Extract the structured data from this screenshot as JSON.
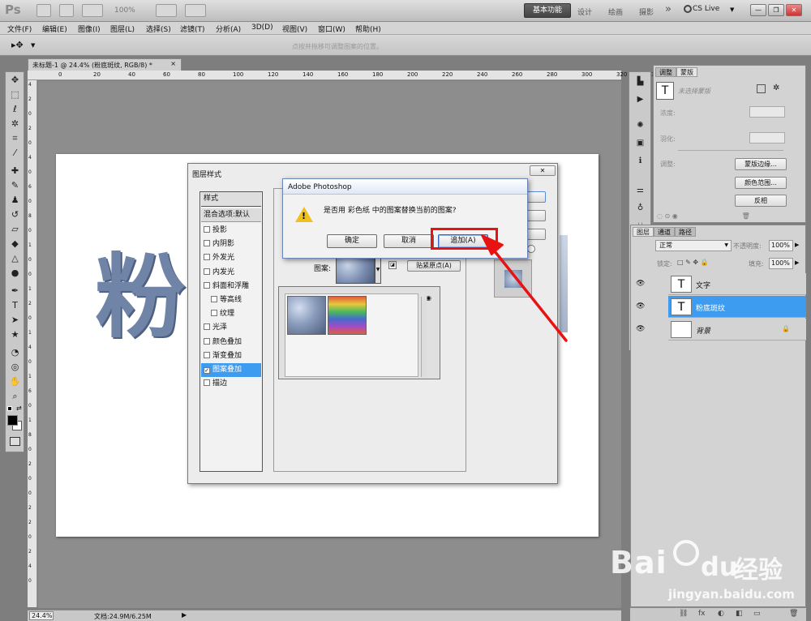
{
  "app": {
    "logo": "Ps",
    "zoom_field": "100%",
    "workspaces": [
      "基本功能",
      "设计",
      "绘画",
      "摄影"
    ],
    "more": "»",
    "cslive": "CS Live",
    "live_dropdown": "▼"
  },
  "menu": [
    "文件(F)",
    "编辑(E)",
    "图像(I)",
    "图层(L)",
    "选择(S)",
    "滤镜(T)",
    "分析(A)",
    "3D(D)",
    "视图(V)",
    "窗口(W)",
    "帮助(H)"
  ],
  "options": {
    "hint": "点按并拖移可调整图案的位置。"
  },
  "document": {
    "tab_title": "未标题-1 @ 24.4% (粉底斑纹, RGB/8) *",
    "tab_close": "×",
    "canvas_text": "粉",
    "canvas_text_right": "",
    "h_ruler": [
      "0",
      "20",
      "40",
      "60",
      "80",
      "100",
      "120",
      "140",
      "160",
      "180",
      "200",
      "220",
      "240",
      "260",
      "280",
      "300",
      "320",
      "340",
      "360",
      "380",
      "400",
      "420",
      "440"
    ],
    "v_ruler": [
      "4",
      "2",
      "0",
      "2",
      "0",
      "4",
      "0",
      "6",
      "0",
      "8",
      "0",
      "1",
      "0",
      "0",
      "1",
      "2",
      "0",
      "1",
      "4",
      "0",
      "1",
      "6",
      "0",
      "1",
      "8",
      "0",
      "2",
      "0",
      "0",
      "2",
      "2",
      "0",
      "2",
      "4",
      "0"
    ]
  },
  "status": {
    "zoom": "24.4%",
    "doc": "文档:24.9M/6.25M"
  },
  "mask_panel": {
    "tabs": [
      "调整",
      "蒙版"
    ],
    "no_selection": "未选择蒙版",
    "density_label": "浓度:",
    "feather_label": "羽化:",
    "refine_label": "调整:",
    "buttons": [
      "蒙版边缘...",
      "颜色范围...",
      "反相"
    ]
  },
  "layers_panel": {
    "tabs": [
      "图层",
      "通道",
      "路径"
    ],
    "blend_mode": "正常",
    "opacity_label": "不透明度:",
    "opacity": "100%",
    "lock_label": "锁定:",
    "fill_label": "填充:",
    "fill": "100%",
    "layers": [
      {
        "name": "文字",
        "thumb": "T",
        "selected": false
      },
      {
        "name": "粉底斑纹",
        "thumb": "T",
        "selected": true
      },
      {
        "name": "背景",
        "thumb": "",
        "selected": false
      }
    ],
    "footer_icons": [
      "⛓",
      "fx",
      "◐",
      "◧",
      "▭",
      "🗑"
    ]
  },
  "layer_style": {
    "title": "图层样式",
    "close": "✕",
    "list_header": "样式",
    "blend": "混合选项:默认",
    "items": [
      {
        "label": "投影",
        "checked": false,
        "indent": false
      },
      {
        "label": "内阴影",
        "checked": false,
        "indent": false
      },
      {
        "label": "外发光",
        "checked": false,
        "indent": false
      },
      {
        "label": "内发光",
        "checked": false,
        "indent": false
      },
      {
        "label": "斜面和浮雕",
        "checked": false,
        "indent": false
      },
      {
        "label": "等高线",
        "checked": false,
        "indent": true
      },
      {
        "label": "纹理",
        "checked": false,
        "indent": true
      },
      {
        "label": "光泽",
        "checked": false,
        "indent": false
      },
      {
        "label": "颜色叠加",
        "checked": false,
        "indent": false
      },
      {
        "label": "渐变叠加",
        "checked": false,
        "indent": false
      },
      {
        "label": "图案叠加",
        "checked": true,
        "indent": false
      },
      {
        "label": "描边",
        "checked": false,
        "indent": false
      }
    ],
    "pattern_label": "图案:",
    "snap_button": "贴紧原点(A)",
    "checkmark": "✓"
  },
  "alert": {
    "title": "Adobe Photoshop",
    "message": "是否用 彩色纸 中的图案替换当前的图案?",
    "ok": "确定",
    "cancel": "取消",
    "append": "追加(A)",
    "warn_glyph": "!"
  },
  "watermark": {
    "brand": "Bai",
    "brand_cn": "经验",
    "url": "jingyan.baidu.com"
  },
  "colors": {
    "highlight_red": "#e81212",
    "selection_blue": "#3d9cf0",
    "alert_border": "#6a86b6"
  }
}
